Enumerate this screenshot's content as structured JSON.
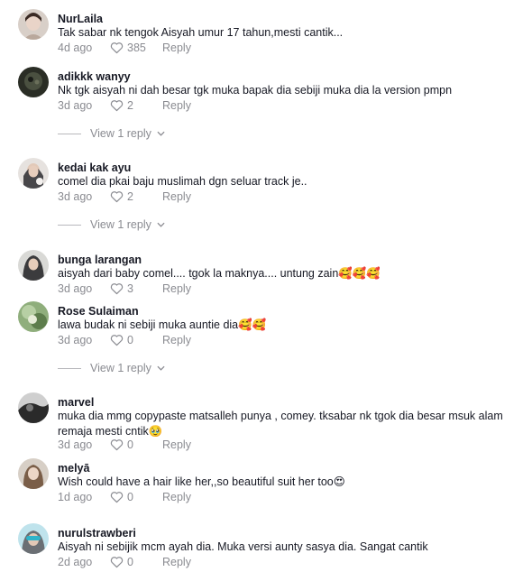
{
  "comments": [
    {
      "username": "NurLaila",
      "text": "Tak sabar nk tengok Aisyah umur 17 tahun,mesti cantik...",
      "date": "4d ago",
      "likes": "385",
      "reply": "Reply"
    },
    {
      "username": "adikkk wanyy",
      "text": "Nk tgk aisyah ni dah besar tgk muka bapak dia sebiji muka dia la version pmpn",
      "date": "3d ago",
      "likes": "2",
      "reply": "Reply",
      "view_replies": "View 1 reply"
    },
    {
      "username": "kedai kak ayu",
      "text": "comel dia pkai baju muslimah dgn seluar track je..",
      "date": "3d ago",
      "likes": "2",
      "reply": "Reply",
      "view_replies": "View 1 reply"
    },
    {
      "username": "bunga larangan",
      "text": "aisyah dari baby comel.... tgok la maknya.... untung zain🥰🥰🥰",
      "date": "3d ago",
      "likes": "3",
      "reply": "Reply"
    },
    {
      "username": "Rose Sulaiman",
      "text": "lawa budak ni sebiji muka auntie dia🥰🥰",
      "date": "3d ago",
      "likes": "0",
      "reply": "Reply",
      "view_replies": "View 1 reply"
    },
    {
      "username": "marvel",
      "text": "muka dia mmg copypaste matsalleh punya , comey. tksabar nk tgok dia besar msuk alam remaja mesti cntik🥹",
      "date": "3d ago",
      "likes": "0",
      "reply": "Reply"
    },
    {
      "username": "melyā",
      "text": "Wish could have a hair like her,,so beautiful suit her too😍",
      "date": "1d ago",
      "likes": "0",
      "reply": "Reply"
    },
    {
      "username": "nurulstrawberi",
      "text": "Aisyah ni sebijik mcm ayah dia. Muka versi aunty sasya dia. Sangat cantik",
      "date": "2d ago",
      "likes": "0",
      "reply": "Reply"
    }
  ],
  "icons": {
    "like": "heart-outline-icon",
    "expand": "chevron-down-icon"
  },
  "colors": {
    "text": "#161823",
    "secondary": "#8a8b91",
    "background": "#ffffff"
  }
}
